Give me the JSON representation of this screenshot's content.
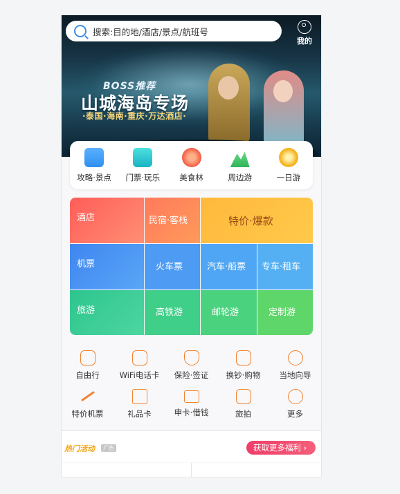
{
  "search": {
    "placeholder": "搜索:目的地/酒店/景点/航班号"
  },
  "account": {
    "label": "我的"
  },
  "banner": {
    "tag": "BOSS推荐",
    "title": "山城海岛专场",
    "subtitle": "·泰国·海南·重庆·万达酒店·"
  },
  "categories": [
    {
      "label": "攻略·景点",
      "icon": "guide-book-icon",
      "color": "#2f8ff0"
    },
    {
      "label": "门票·玩乐",
      "icon": "ticket-icon",
      "color": "#27c0c8"
    },
    {
      "label": "美食林",
      "icon": "food-icon",
      "color": "#f25a42"
    },
    {
      "label": "周边游",
      "icon": "mountain-icon",
      "color": "#3fc46a"
    },
    {
      "label": "一日游",
      "icon": "sun-badge-icon",
      "color": "#f6b521"
    }
  ],
  "grid": {
    "hotel": "酒店",
    "homestay": "民宿·客栈",
    "deals": "特价·爆款",
    "flight": "机票",
    "train": "火车票",
    "bus_ship": "汽车·船票",
    "car": "专车·租车",
    "travel": "旅游",
    "highspeed": "高铁游",
    "cruise": "邮轮游",
    "custom": "定制游"
  },
  "services": [
    {
      "label": "自由行",
      "icon": "backpack-icon"
    },
    {
      "label": "WiFi电话卡",
      "icon": "wifi-sim-icon"
    },
    {
      "label": "保险·签证",
      "icon": "shield-icon"
    },
    {
      "label": "换钞·购物",
      "icon": "shopping-bag-icon"
    },
    {
      "label": "当地向导",
      "icon": "guide-hat-icon"
    },
    {
      "label": "特价机票",
      "icon": "plane-icon"
    },
    {
      "label": "礼品卡",
      "icon": "gift-card-icon"
    },
    {
      "label": "申卡·借钱",
      "icon": "credit-card-icon"
    },
    {
      "label": "旅拍",
      "icon": "camera-icon"
    },
    {
      "label": "更多",
      "icon": "more-icon"
    }
  ],
  "activity": {
    "title": "热门活动",
    "ad": "广告",
    "button": "获取更多福利"
  }
}
